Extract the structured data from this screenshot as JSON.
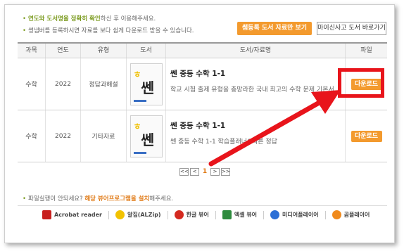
{
  "notices": {
    "line1_highlight": "연도와 도서명을 정확히 확인",
    "line1_rest": "하신 후 이용해주세요.",
    "line2": "썽냄버를 등록하시면 자료를 보다 쉽게 다운로드 받을 수 있습니다."
  },
  "buttons": {
    "registered_only": "쌤등록 도서 자료만 보기",
    "my_bookshelf": "마이신사고 도서 바로가기"
  },
  "table": {
    "headers": [
      "과목",
      "연도",
      "유형",
      "도서",
      "도서/자료명",
      "파일"
    ],
    "rows": [
      {
        "subject": "수학",
        "year": "2022",
        "type": "정답과해설",
        "title": "쎈 중등 수학 1-1",
        "desc": "학교 시험 출제 유형을 총망라한 국내 최고의 수학 문제 기본서",
        "download": "다운로드"
      },
      {
        "subject": "수학",
        "year": "2022",
        "type": "기타자료",
        "title": "쎈 중등 수학 1-1",
        "desc": "쎈 중등 수학 1-1 학습플래너&빠른 정답",
        "download": "다운로드"
      }
    ],
    "cover_glyph": "쎈"
  },
  "pagination": {
    "first": "<<",
    "prev": "<",
    "current": "1",
    "next": ">",
    "last": ">>"
  },
  "help": {
    "prefix": "파일실행이 안되세요?",
    "highlight": "해당 뷰어프로그램을 설치",
    "suffix": "해주세요."
  },
  "viewers": [
    {
      "label": "Acrobat reader",
      "icon": "acrobat-icon",
      "color": "#c8201e"
    },
    {
      "label": "알집(ALZip)",
      "icon": "alzip-icon",
      "color": "#f2c200"
    },
    {
      "label": "한글 뷰어",
      "icon": "hwp-icon",
      "color": "#d42a20"
    },
    {
      "label": "엑셀 뷰어",
      "icon": "excel-icon",
      "color": "#2e8b3e"
    },
    {
      "label": "미디어플레이어",
      "icon": "mediaplayer-icon",
      "color": "#2b6fd6"
    },
    {
      "label": "곰플레이어",
      "icon": "gomplayer-icon",
      "color": "#f08a1c"
    }
  ],
  "colors": {
    "accent_orange": "#f39a2e",
    "highlight_green": "#7a9a1d",
    "annotation_red": "#e8141b"
  }
}
